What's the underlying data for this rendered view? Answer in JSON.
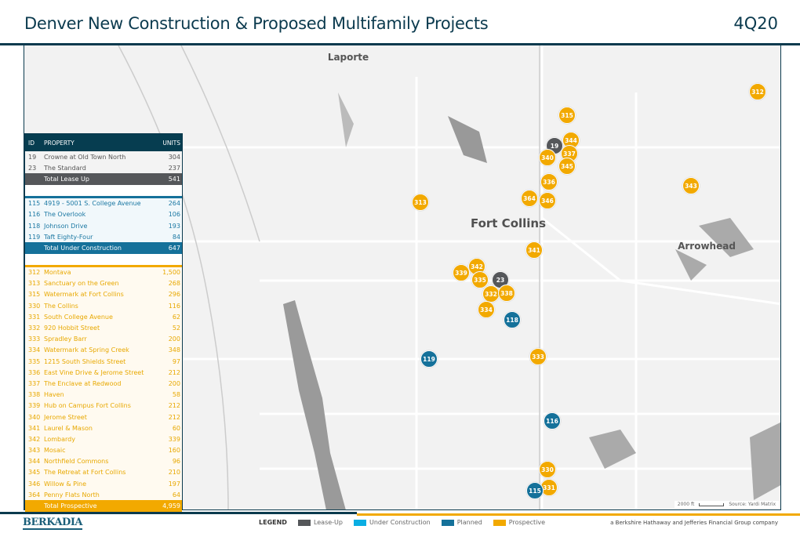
{
  "header": {
    "title": "Denver New Construction & Proposed Multifamily Projects",
    "quarter": "4Q20"
  },
  "colors": {
    "lease_up": "#55575a",
    "under_construction": "#0aaee3",
    "planned": "#15719a",
    "prospective": "#f2a900",
    "brand": "#0b3a4e"
  },
  "table": {
    "columns": {
      "id": "ID",
      "property": "PROPERTY",
      "units": "UNITS"
    },
    "lease_up": {
      "rows": [
        {
          "id": "19",
          "name": "Crowne at Old Town North",
          "units": "304"
        },
        {
          "id": "23",
          "name": "The Standard",
          "units": "237"
        }
      ],
      "total_label": "Total Lease Up",
      "total": "541"
    },
    "under_construction": {
      "rows": [
        {
          "id": "115",
          "name": "4919 - 5001 S. College Avenue",
          "units": "264"
        },
        {
          "id": "116",
          "name": "The Overlook",
          "units": "106"
        },
        {
          "id": "118",
          "name": "Johnson Drive",
          "units": "193"
        },
        {
          "id": "119",
          "name": "Taft Eighty-Four",
          "units": "84"
        }
      ],
      "total_label": "Total Under Construction",
      "total": "647"
    },
    "prospective": {
      "rows": [
        {
          "id": "312",
          "name": "Montava",
          "units": "1,500"
        },
        {
          "id": "313",
          "name": "Sanctuary on the Green",
          "units": "268"
        },
        {
          "id": "315",
          "name": "Watermark at Fort Collins",
          "units": "296"
        },
        {
          "id": "330",
          "name": "The Collins",
          "units": "116"
        },
        {
          "id": "331",
          "name": "South College Avenue",
          "units": "62"
        },
        {
          "id": "332",
          "name": "920 Hobbit Street",
          "units": "52"
        },
        {
          "id": "333",
          "name": "Spradley Barr",
          "units": "200"
        },
        {
          "id": "334",
          "name": "Watermark at Spring Creek",
          "units": "348"
        },
        {
          "id": "335",
          "name": "1215 South Shields Street",
          "units": "97"
        },
        {
          "id": "336",
          "name": "East Vine Drive & Jerome Street",
          "units": "212"
        },
        {
          "id": "337",
          "name": "The Enclave at Redwood",
          "units": "200"
        },
        {
          "id": "338",
          "name": "Haven",
          "units": "58"
        },
        {
          "id": "339",
          "name": "Hub on Campus Fort Collins",
          "units": "212"
        },
        {
          "id": "340",
          "name": "Jerome Street",
          "units": "212"
        },
        {
          "id": "341",
          "name": "Laurel & Mason",
          "units": "60"
        },
        {
          "id": "342",
          "name": "Lombardy",
          "units": "339"
        },
        {
          "id": "343",
          "name": "Mosaic",
          "units": "160"
        },
        {
          "id": "344",
          "name": "Northfield Commons",
          "units": "96"
        },
        {
          "id": "345",
          "name": "The Retreat at Fort Collins",
          "units": "210"
        },
        {
          "id": "346",
          "name": "Willow & Pine",
          "units": "197"
        },
        {
          "id": "364",
          "name": "Penny Flats North",
          "units": "64"
        }
      ],
      "total_label": "Total Prospective",
      "total": "4,959"
    }
  },
  "map": {
    "labels": [
      {
        "text": "Laporte",
        "size": "normal"
      },
      {
        "text": "Fort Collins",
        "size": "big"
      },
      {
        "text": "Arrowhead",
        "size": "normal"
      }
    ],
    "markers": [
      {
        "id": "312",
        "cat": "prospective"
      },
      {
        "id": "315",
        "cat": "prospective"
      },
      {
        "id": "19",
        "cat": "lease_up"
      },
      {
        "id": "344",
        "cat": "prospective"
      },
      {
        "id": "337",
        "cat": "prospective"
      },
      {
        "id": "340",
        "cat": "prospective"
      },
      {
        "id": "345",
        "cat": "prospective"
      },
      {
        "id": "336",
        "cat": "prospective"
      },
      {
        "id": "343",
        "cat": "prospective"
      },
      {
        "id": "313",
        "cat": "prospective"
      },
      {
        "id": "364",
        "cat": "prospective"
      },
      {
        "id": "346",
        "cat": "prospective"
      },
      {
        "id": "341",
        "cat": "prospective"
      },
      {
        "id": "342",
        "cat": "prospective"
      },
      {
        "id": "339",
        "cat": "prospective"
      },
      {
        "id": "335",
        "cat": "prospective"
      },
      {
        "id": "23",
        "cat": "lease_up"
      },
      {
        "id": "332",
        "cat": "prospective"
      },
      {
        "id": "338",
        "cat": "prospective"
      },
      {
        "id": "334",
        "cat": "prospective"
      },
      {
        "id": "118",
        "cat": "planned"
      },
      {
        "id": "119",
        "cat": "planned"
      },
      {
        "id": "333",
        "cat": "prospective"
      },
      {
        "id": "116",
        "cat": "planned"
      },
      {
        "id": "330",
        "cat": "prospective"
      },
      {
        "id": "331",
        "cat": "prospective"
      },
      {
        "id": "115",
        "cat": "planned"
      }
    ],
    "scale_label": "2000 ft",
    "source": "Source: Yardi Matrix"
  },
  "footer": {
    "logo": "BERKADIA",
    "legend_title": "LEGEND",
    "legend": [
      "Lease-Up",
      "Under Construction",
      "Planned",
      "Prospective"
    ],
    "company": "a Berkshire Hathaway and Jefferies Financial Group company"
  }
}
